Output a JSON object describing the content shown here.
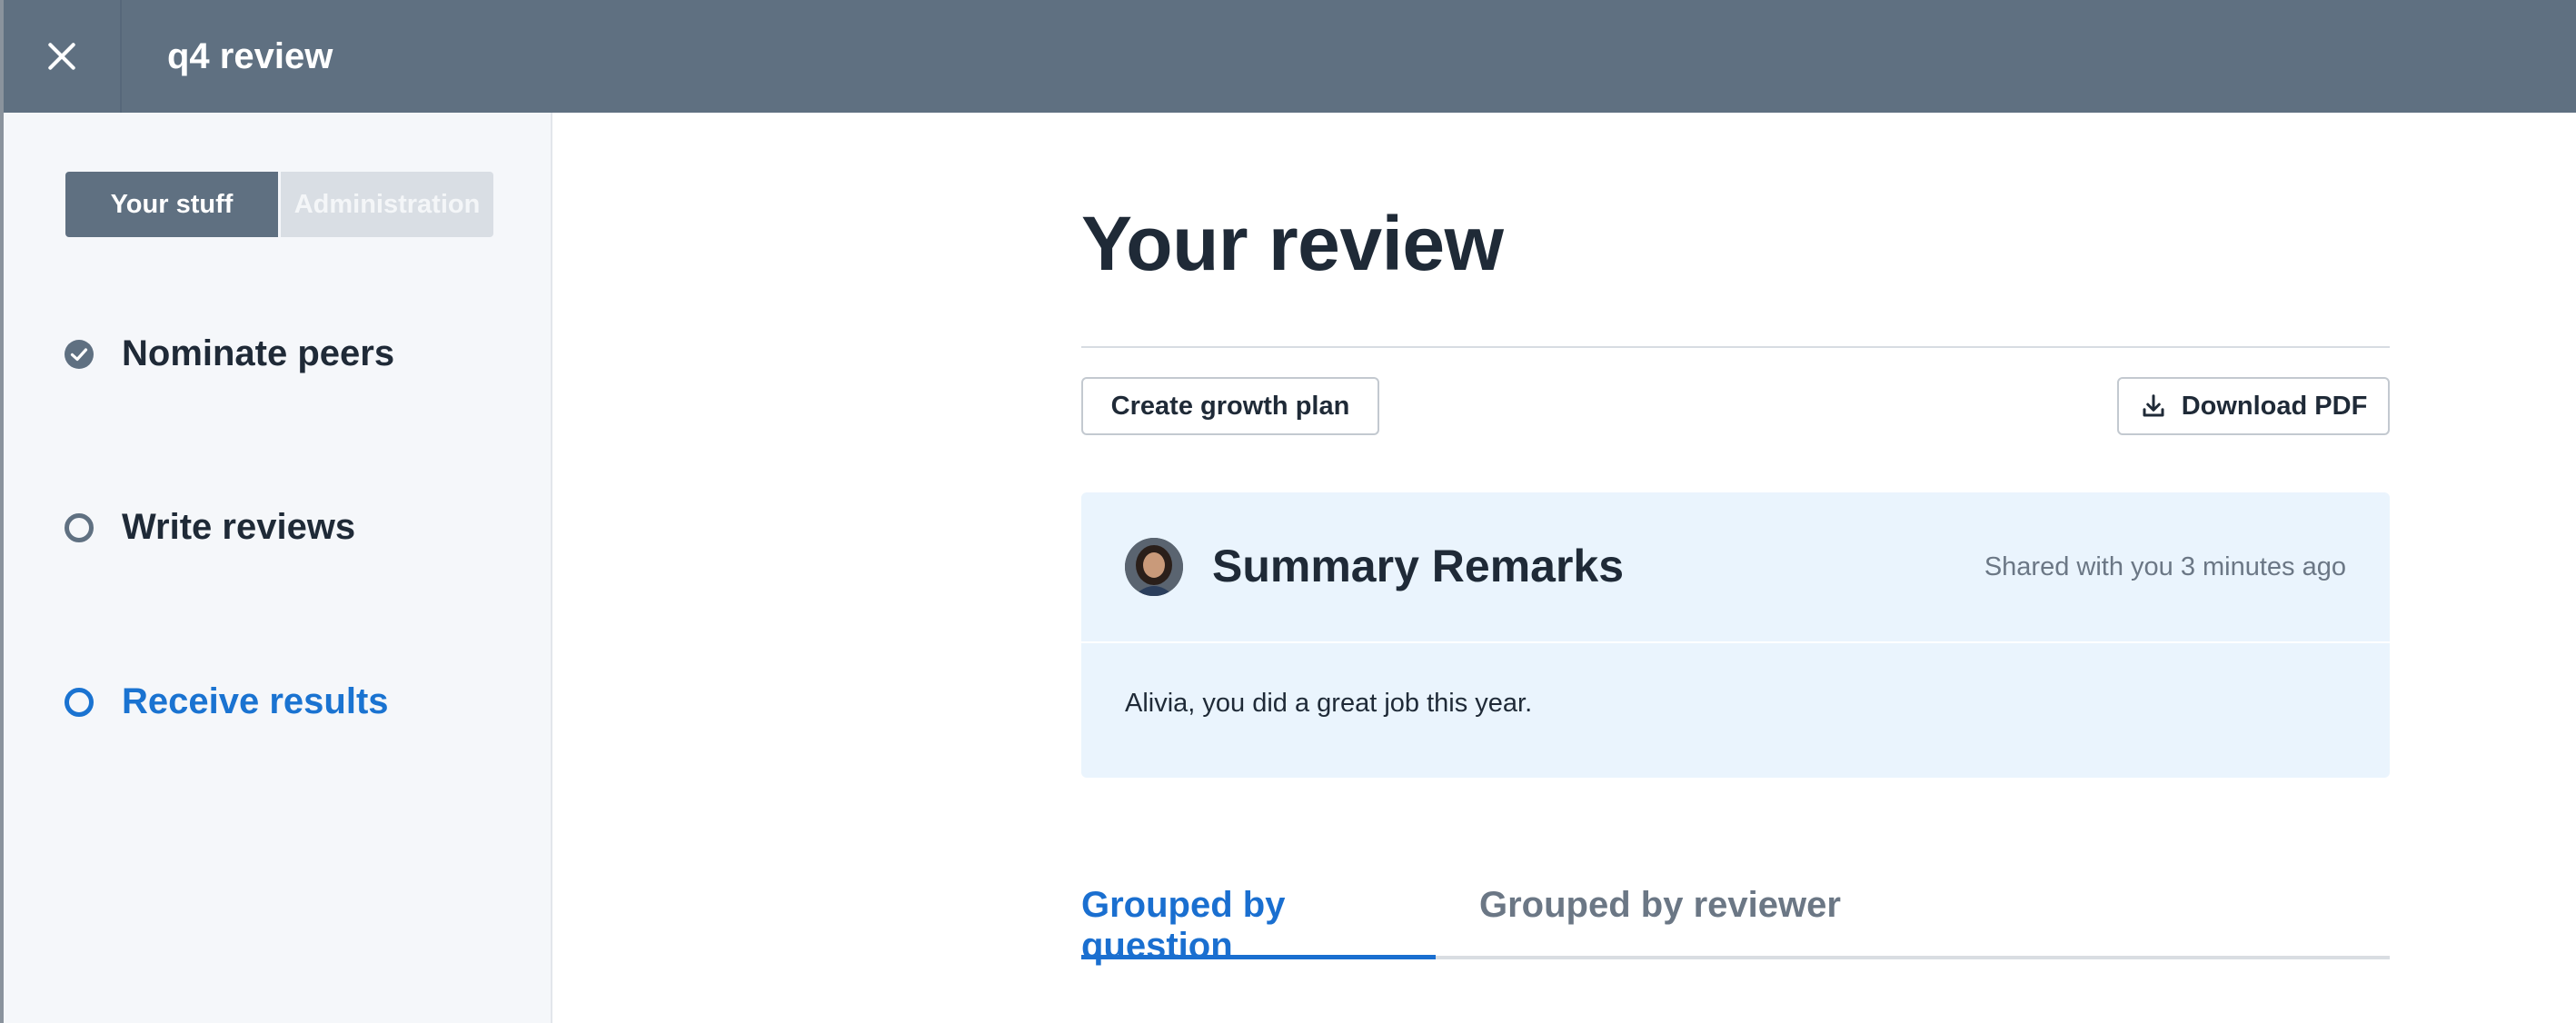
{
  "window": {
    "title": "q4 review",
    "close_icon": "close-icon"
  },
  "sidebar": {
    "segments": [
      {
        "label": "Your stuff",
        "active": true
      },
      {
        "label": "Administration",
        "active": false
      }
    ],
    "steps": [
      {
        "label": "Nominate peers",
        "status": "completed",
        "icon": "check-circle-icon"
      },
      {
        "label": "Write reviews",
        "status": "pending",
        "icon": "circle-outline-icon"
      },
      {
        "label": "Receive results",
        "status": "current",
        "icon": "circle-outline-icon"
      }
    ]
  },
  "main": {
    "title": "Your review",
    "actions": {
      "growth_label": "Create growth plan",
      "pdf_label": "Download PDF",
      "pdf_icon": "download-icon"
    },
    "summary": {
      "title": "Summary Remarks",
      "meta": "Shared with you 3 minutes ago",
      "body": "Alivia, you did a great job this year."
    },
    "tabs": [
      {
        "label": "Grouped by question",
        "active": true
      },
      {
        "label": "Grouped by reviewer",
        "active": false
      }
    ]
  },
  "colors": {
    "topbar": "#5f7081",
    "accent": "#1a73d1",
    "card_bg": "#eaf4fd",
    "sidebar_bg": "#f5f7fa"
  }
}
